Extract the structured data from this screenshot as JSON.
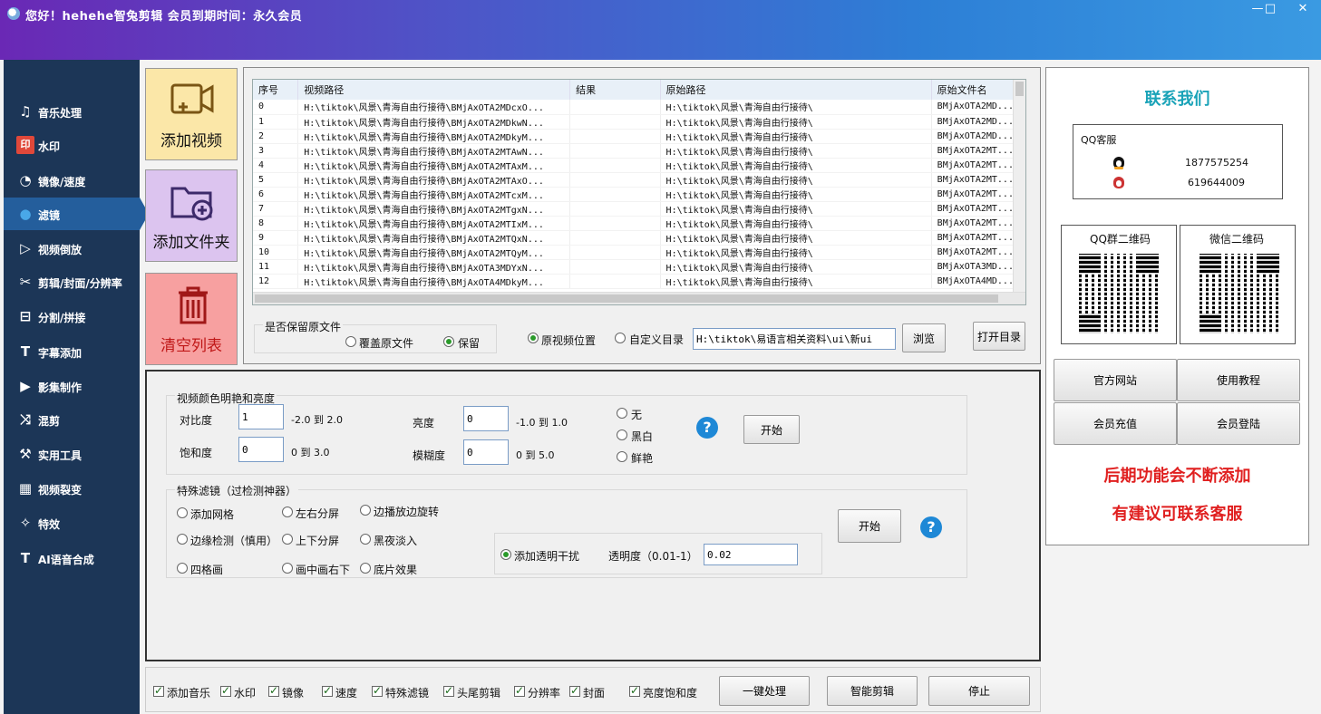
{
  "window": {
    "title": "您好！hehehe智兔剪辑  会员到期时间：永久会员",
    "minimize": "—",
    "maximize": "□",
    "close": "✕"
  },
  "sidebar": {
    "items": [
      {
        "label": "音乐处理",
        "icon": "music-note-icon",
        "glyph": "♫"
      },
      {
        "label": "水印",
        "icon": "watermark-icon",
        "glyph": "印"
      },
      {
        "label": "镜像/速度",
        "icon": "speedometer-icon",
        "glyph": "◔"
      },
      {
        "label": "滤镜",
        "icon": "filter-icon",
        "glyph": "●"
      },
      {
        "label": "视频倒放",
        "icon": "reverse-play-icon",
        "glyph": "▷"
      },
      {
        "label": "剪辑/封面/分辨率",
        "icon": "scissors-icon",
        "glyph": "✂"
      },
      {
        "label": "分割/拼接",
        "icon": "split-join-icon",
        "glyph": "⊟"
      },
      {
        "label": "字幕添加",
        "icon": "subtitle-icon",
        "glyph": "T"
      },
      {
        "label": "影集制作",
        "icon": "album-icon",
        "glyph": "▶"
      },
      {
        "label": "混剪",
        "icon": "shuffle-icon",
        "glyph": "⤨"
      },
      {
        "label": "实用工具",
        "icon": "toolbox-icon",
        "glyph": "⚒"
      },
      {
        "label": "视频裂变",
        "icon": "film-icon",
        "glyph": "▦"
      },
      {
        "label": "特效",
        "icon": "effects-icon",
        "glyph": "✧"
      },
      {
        "label": "AI语音合成",
        "icon": "ai-voice-icon",
        "glyph": "T"
      }
    ],
    "active_index": 3
  },
  "actions": {
    "add_video": "添加视频",
    "add_folder": "添加文件夹",
    "clear_list": "清空列表",
    "colors": {
      "add_video_bg": "#fbe7a8",
      "add_folder_bg": "#dcc4ef",
      "clear_bg": "#f7a0a0"
    }
  },
  "file_table": {
    "columns": [
      "序号",
      "视频路径",
      "结果",
      "原始路径",
      "原始文件名"
    ],
    "rows": [
      [
        "0",
        "H:\\tiktok\\风景\\青海自由行接待\\BMjAxOTA2MDcxO...",
        "",
        "H:\\tiktok\\风景\\青海自由行接待\\",
        "BMjAxOTA2MD..."
      ],
      [
        "1",
        "H:\\tiktok\\风景\\青海自由行接待\\BMjAxOTA2MDkwN...",
        "",
        "H:\\tiktok\\风景\\青海自由行接待\\",
        "BMjAxOTA2MD..."
      ],
      [
        "2",
        "H:\\tiktok\\风景\\青海自由行接待\\BMjAxOTA2MDkyM...",
        "",
        "H:\\tiktok\\风景\\青海自由行接待\\",
        "BMjAxOTA2MD..."
      ],
      [
        "3",
        "H:\\tiktok\\风景\\青海自由行接待\\BMjAxOTA2MTAwN...",
        "",
        "H:\\tiktok\\风景\\青海自由行接待\\",
        "BMjAxOTA2MT..."
      ],
      [
        "4",
        "H:\\tiktok\\风景\\青海自由行接待\\BMjAxOTA2MTAxM...",
        "",
        "H:\\tiktok\\风景\\青海自由行接待\\",
        "BMjAxOTA2MT..."
      ],
      [
        "5",
        "H:\\tiktok\\风景\\青海自由行接待\\BMjAxOTA2MTAxO...",
        "",
        "H:\\tiktok\\风景\\青海自由行接待\\",
        "BMjAxOTA2MT..."
      ],
      [
        "6",
        "H:\\tiktok\\风景\\青海自由行接待\\BMjAxOTA2MTcxM...",
        "",
        "H:\\tiktok\\风景\\青海自由行接待\\",
        "BMjAxOTA2MT..."
      ],
      [
        "7",
        "H:\\tiktok\\风景\\青海自由行接待\\BMjAxOTA2MTgxN...",
        "",
        "H:\\tiktok\\风景\\青海自由行接待\\",
        "BMjAxOTA2MT..."
      ],
      [
        "8",
        "H:\\tiktok\\风景\\青海自由行接待\\BMjAxOTA2MTIxM...",
        "",
        "H:\\tiktok\\风景\\青海自由行接待\\",
        "BMjAxOTA2MT..."
      ],
      [
        "9",
        "H:\\tiktok\\风景\\青海自由行接待\\BMjAxOTA2MTQxN...",
        "",
        "H:\\tiktok\\风景\\青海自由行接待\\",
        "BMjAxOTA2MT..."
      ],
      [
        "10",
        "H:\\tiktok\\风景\\青海自由行接待\\BMjAxOTA2MTQyM...",
        "",
        "H:\\tiktok\\风景\\青海自由行接待\\",
        "BMjAxOTA2MT..."
      ],
      [
        "11",
        "H:\\tiktok\\风景\\青海自由行接待\\BMjAxOTA3MDYxN...",
        "",
        "H:\\tiktok\\风景\\青海自由行接待\\",
        "BMjAxOTA3MD..."
      ],
      [
        "12",
        "H:\\tiktok\\风景\\青海自由行接待\\BMjAxOTA4MDkyM...",
        "",
        "H:\\tiktok\\风景\\青海自由行接待\\",
        "BMjAxOTA4MD..."
      ]
    ]
  },
  "output": {
    "keep_original_title": "是否保留原文件",
    "overwrite_label": "覆盖原文件",
    "keep_label": "保留",
    "keep_selected": "keep",
    "orig_location_label": "原视频位置",
    "custom_dir_label": "自定义目录",
    "location_selected": "original",
    "dir_value": "H:\\tiktok\\易语言相关资料\\ui\\新ui",
    "browse": "浏览",
    "open_dir": "打开目录"
  },
  "color_adjust": {
    "title": "视频颜色明艳和亮度",
    "contrast_label": "对比度",
    "contrast_value": "1",
    "contrast_range": "-2.0 到 2.0",
    "saturation_label": "饱和度",
    "saturation_value": "0",
    "saturation_range": "0 到 3.0",
    "brightness_label": "亮度",
    "brightness_value": "0",
    "brightness_range": "-1.0 到 1.0",
    "blur_label": "模糊度",
    "blur_value": "0",
    "blur_range": "0 到 5.0",
    "mode_none": "无",
    "mode_bw": "黑白",
    "mode_vivid": "鲜艳",
    "help": "?",
    "start": "开始"
  },
  "special_filters": {
    "title": "特殊滤镜（过检测神器）",
    "options": {
      "add_grid": "添加网格",
      "split_lr": "左右分屏",
      "edge_rotate": "边播放边旋转",
      "edge_detect": "边缘检测（慎用）",
      "split_tb": "上下分屏",
      "night_fade": "黑夜淡入",
      "four_grid": "四格画",
      "pip": "画中画右下",
      "film": "底片效果"
    },
    "transparency_label": "添加透明干扰",
    "opacity_label": "透明度（0.01-1）",
    "opacity_value": "0.02",
    "start": "开始",
    "help": "?"
  },
  "bottom_bar": {
    "checks": [
      "添加音乐",
      "水印",
      "镜像",
      "速度",
      "特殊滤镜",
      "头尾剪辑",
      "分辨率",
      "封面",
      "亮度饱和度"
    ],
    "one_click": "一键处理",
    "smart_edit": "智能剪辑",
    "stop": "停止"
  },
  "contact": {
    "title": "联系我们",
    "qq_service_label": "QQ客服",
    "qq1": "1877575254",
    "qq2": "619644009",
    "qq_group_qr": "QQ群二维码",
    "wechat_qr": "微信二维码",
    "official_site": "官方网站",
    "tutorial": "使用教程",
    "recharge": "会员充值",
    "login": "会员登陆",
    "notice1": "后期功能会不断添加",
    "notice2": "有建议可联系客服",
    "accent": "#1aa3b8",
    "notice_color": "#e02020"
  }
}
